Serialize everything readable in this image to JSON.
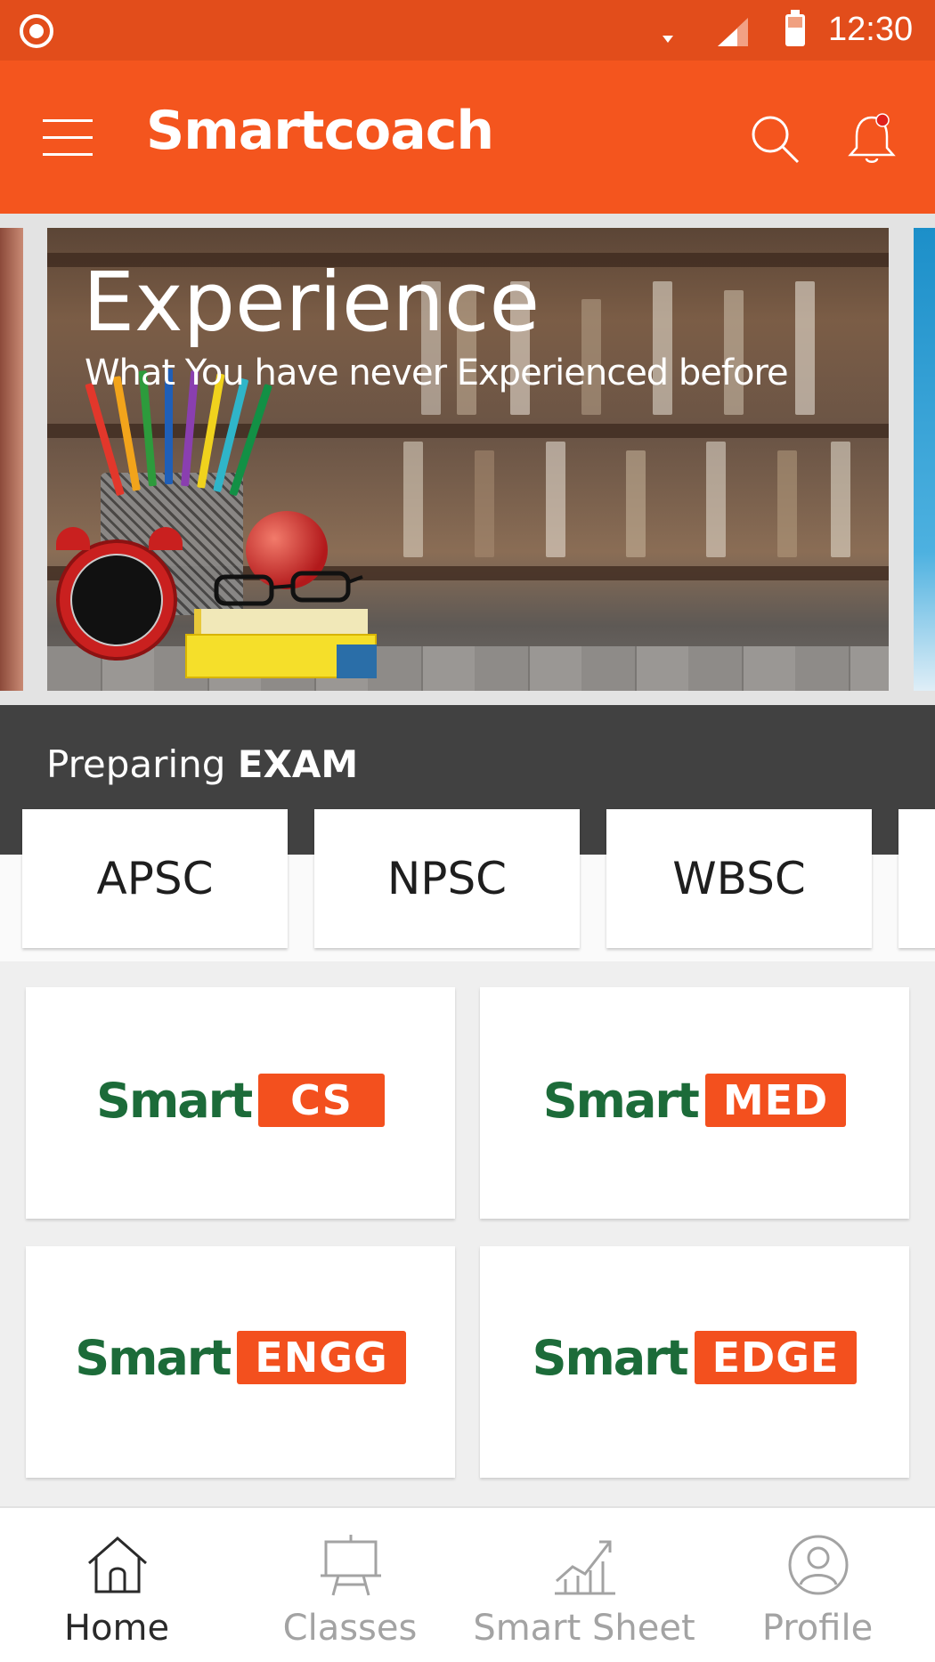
{
  "status_bar": {
    "time": "12:30"
  },
  "app_bar": {
    "title": "Smartcoach"
  },
  "banner": {
    "headline": "Experience",
    "subline": "What You have never Experienced before"
  },
  "exam_section": {
    "title_prefix": "Preparing ",
    "title_bold": "EXAM",
    "exams": [
      "APSC",
      "NPSC",
      "WBSC"
    ]
  },
  "programs": [
    {
      "brand": "Smart",
      "tag": "CS"
    },
    {
      "brand": "Smart",
      "tag": "MED"
    },
    {
      "brand": "Smart",
      "tag": "ENGG"
    },
    {
      "brand": "Smart",
      "tag": "EDGE"
    }
  ],
  "bottom_nav": {
    "items": [
      {
        "label": "Home",
        "icon": "home-icon",
        "active": true
      },
      {
        "label": "Classes",
        "icon": "classroom-board-icon",
        "active": false
      },
      {
        "label": "Smart Sheet",
        "icon": "growth-chart-icon",
        "active": false
      },
      {
        "label": "Profile",
        "icon": "profile-icon",
        "active": false
      }
    ]
  },
  "colors": {
    "status_bar": "#e24d1b",
    "app_bar": "#f4551e",
    "brand_green": "#1c6b39",
    "brand_orange": "#f3501e",
    "exam_band": "#414141",
    "nav_active": "#2a2a2a",
    "nav_inactive": "#a3a3a3"
  }
}
